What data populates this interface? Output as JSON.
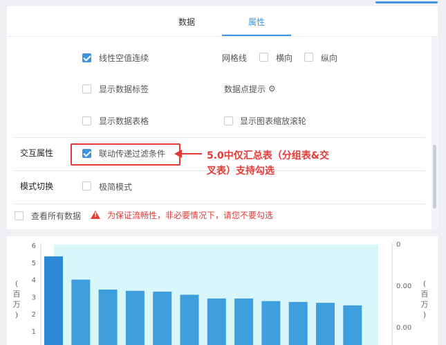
{
  "tabs": [
    {
      "label": "数据",
      "active": false
    },
    {
      "label": "属性",
      "active": true
    }
  ],
  "options": {
    "line_null_connect": "线性空值连续",
    "gridlines_label": "网格线",
    "grid_horizontal": "横向",
    "grid_vertical": "纵向",
    "show_data_labels": "显示数据标签",
    "data_point_tip": "数据点提示",
    "show_data_table": "显示数据表格",
    "show_zoom_wheel": "显示图表缩放滚轮"
  },
  "sections": {
    "interaction": "交互属性",
    "linked_filter": "联动传递过滤条件",
    "mode_switch": "模式切换",
    "simple_mode": "极简模式"
  },
  "view_all_data": "查看所有数据",
  "warning_text": "为保证流畅性，非必要情况下，请您不要勾选",
  "annotation": "5.0中仅汇总表（分组表&交叉表）支持勾选",
  "colors": {
    "accent": "#3e93e0",
    "warning": "#e53935",
    "bar": "#3f9ede",
    "bar_first": "#2e8ad8",
    "highlight_band": "#d9f7fb"
  },
  "chart_data": {
    "type": "bar",
    "left_axis": {
      "label_chars": [
        "(",
        "百",
        "万",
        ")"
      ],
      "ticks": [
        "6",
        "5",
        "4",
        "3",
        "2",
        "1"
      ],
      "range": [
        0,
        6
      ]
    },
    "right_axis": {
      "label_chars": [
        "(",
        "百",
        "万",
        ")"
      ],
      "ticks": [
        "0",
        "0.00",
        "0.00"
      ]
    },
    "values": [
      5.35,
      4.0,
      3.42,
      3.35,
      3.3,
      3.12,
      2.9,
      2.9,
      2.75,
      2.7,
      2.65,
      2.5
    ]
  }
}
